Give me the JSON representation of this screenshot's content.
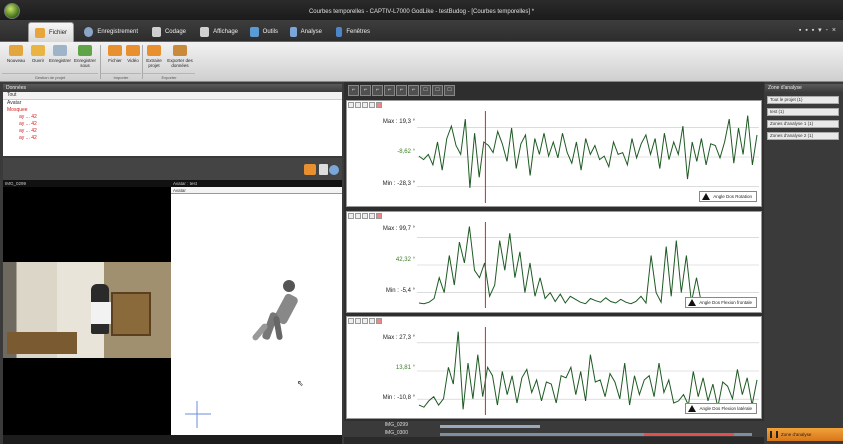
{
  "window": {
    "title": "Courbes temporelles - CAPTIV-L7000 GodLike - testBudog - [Courbes temporelles] *",
    "controls": "▪ ▪ ▪ ▾ -  ×"
  },
  "tabs": [
    {
      "label": "Fichier",
      "color": "#e8a53b"
    },
    {
      "label": "Enregistrement",
      "color": "#8aa5c8"
    },
    {
      "label": "Codage",
      "color": "#cfcfcf"
    },
    {
      "label": "Affichage",
      "color": "#d0d0d0"
    },
    {
      "label": "Outils",
      "color": "#5b9bd5"
    },
    {
      "label": "Analyse",
      "color": "#7aa7d8"
    },
    {
      "label": "Fenêtres",
      "color": "#4a86c8"
    }
  ],
  "ribbon": {
    "buttons": [
      {
        "label": "Nouveau",
        "color": "#e2a63c"
      },
      {
        "label": "Ouvrir",
        "color": "#e9b443"
      },
      {
        "label": "Enregistrer",
        "color": "#9fb4c8"
      },
      {
        "label": "Enregistrer sous",
        "color": "#5fa548"
      },
      {
        "label": "Fichier",
        "color": "#e8902f"
      },
      {
        "label": "Vidéo",
        "color": "#e8902f"
      },
      {
        "label": "Extraire projet",
        "color": "#e8902f"
      },
      {
        "label": "Exporter des données",
        "color": "#c98a3c"
      }
    ],
    "groups": [
      "Gestion de projet",
      "Importer",
      "Exporter"
    ]
  },
  "data_panel": {
    "header": "Données",
    "filter": "Tout",
    "tree": [
      {
        "label": "Avatar",
        "color": "normal"
      },
      {
        "label": "Mosquee",
        "color": "red"
      },
      {
        "label": "ay  ... 42",
        "color": "red"
      },
      {
        "label": "ay  ... 42",
        "color": "red"
      },
      {
        "label": "ay  ... 42",
        "color": "red"
      },
      {
        "label": "ay  ... 42",
        "color": "red"
      }
    ]
  },
  "video_panel": {
    "left_header": "IMG_0299",
    "right_header": "Avatar : test",
    "selector": "Avatar"
  },
  "chart_data": [
    {
      "type": "line",
      "series": [
        {
          "name": "Angle Dos Rotation",
          "values": [
            -4,
            -6,
            -3,
            -9,
            4,
            -12,
            6,
            13,
            2,
            -3,
            17,
            -22,
            9,
            -16,
            4,
            2,
            -2,
            10,
            3,
            -7,
            12,
            -11,
            3,
            8,
            -15,
            6,
            -3,
            9,
            -4,
            4,
            -5,
            9,
            -2,
            -8,
            4,
            -12,
            6,
            -3,
            2,
            -6,
            -4,
            -10,
            4,
            -3,
            -2,
            -9,
            6,
            -5,
            3,
            8,
            -3,
            6,
            -11,
            9,
            -6,
            4,
            -3,
            13,
            -17,
            4,
            -7,
            6,
            -9,
            3,
            2,
            -5,
            4,
            17,
            -8,
            12,
            -3,
            19,
            -9,
            8
          ]
        }
      ],
      "max_label": "Max : 19,3 °",
      "mid_label": "-8,62 °",
      "min_label": "Min : -28,3 °",
      "ylim": [
        -28.3,
        19.3
      ]
    },
    {
      "type": "line",
      "series": [
        {
          "name": "Angle Dos Flexion frontale",
          "values": [
            -4,
            -5,
            -3,
            2,
            30,
            10,
            60,
            20,
            78,
            50,
            99,
            40,
            30,
            50,
            5,
            20,
            80,
            40,
            90,
            30,
            65,
            10,
            50,
            5,
            30,
            2,
            10,
            -2,
            8,
            -4,
            5,
            1,
            -3,
            -5,
            2,
            -1,
            -3,
            3,
            -2,
            -4,
            1,
            -3,
            -5,
            -2,
            5,
            -4,
            60,
            10,
            -3,
            72,
            5,
            80,
            10,
            60,
            -3,
            30,
            -5,
            -2,
            2,
            -4,
            1,
            -3,
            -5,
            2,
            -3,
            1,
            -4,
            -2
          ]
        }
      ],
      "max_label": "Max : 99,7 °",
      "mid_label": "42,32 °",
      "min_label": "Min : -5,4 °",
      "ylim": [
        -5.4,
        99.7
      ]
    },
    {
      "type": "line",
      "series": [
        {
          "name": "Angle Dos Flexion latérale",
          "values": [
            -8,
            -9,
            -6,
            -4,
            -8,
            -5,
            10,
            2,
            27,
            -10,
            12,
            -5,
            16,
            -4,
            10,
            6,
            -8,
            8,
            -3,
            6,
            -7,
            5,
            9,
            -2,
            4,
            -6,
            3,
            2,
            -7,
            6,
            5,
            10,
            -3,
            8,
            -6,
            16,
            3,
            4,
            -4,
            7,
            3,
            -5,
            12,
            -8,
            6,
            -3,
            4,
            6,
            -4,
            12,
            -2,
            4,
            -7,
            -6,
            -3,
            -8,
            8,
            -4,
            5,
            -6,
            2,
            -9,
            3,
            1,
            -5,
            9,
            -3,
            5,
            -8,
            4
          ]
        }
      ],
      "max_label": "Max : 27,3 °",
      "mid_label": "13,81 °",
      "min_label": "Min : -10,8 °",
      "ylim": [
        -10.8,
        27.3
      ]
    }
  ],
  "cursor_position": 0.2,
  "timeline": {
    "rows": [
      "IMG_0299",
      "IMG_0300"
    ]
  },
  "analysis_panel": {
    "header": "Zone d'analyse",
    "items": [
      "Tout le projet (1)",
      "test (1)",
      "Zones d'analyse 1 (1)",
      "Zones d'analyse 2 (1)"
    ],
    "bottom_button": "Zone d'analyse"
  },
  "colors": {
    "signal": "#1e5a23",
    "cursor": "#e02020",
    "mid": "#3a7d22"
  }
}
